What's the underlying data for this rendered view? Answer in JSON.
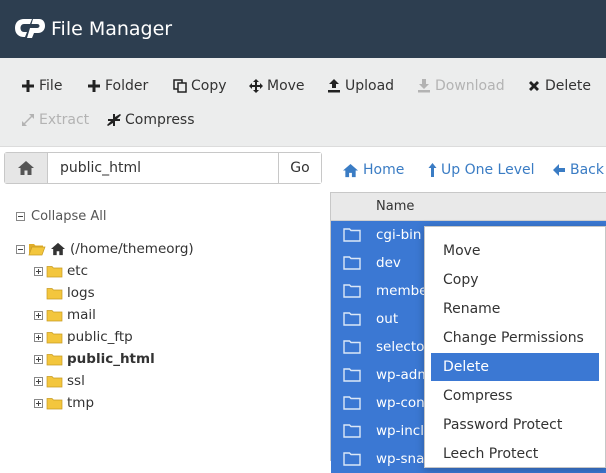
{
  "app": {
    "title": "File Manager",
    "logo_icon": "cpanel-logo-icon"
  },
  "toolbar": {
    "row1": [
      {
        "label": "File",
        "icon": "plus-icon",
        "enabled": true
      },
      {
        "label": "Folder",
        "icon": "plus-icon",
        "enabled": true
      },
      {
        "label": "Copy",
        "icon": "copy-icon",
        "enabled": true
      },
      {
        "label": "Move",
        "icon": "move-arrows-icon",
        "enabled": true
      },
      {
        "label": "Upload",
        "icon": "upload-icon",
        "enabled": true
      },
      {
        "label": "Download",
        "icon": "download-icon",
        "enabled": false
      },
      {
        "label": "Delete",
        "icon": "x-icon",
        "enabled": true
      }
    ],
    "row2": [
      {
        "label": "Extract",
        "icon": "expand-icon",
        "enabled": false
      },
      {
        "label": "Compress",
        "icon": "compress-icon",
        "enabled": true
      }
    ]
  },
  "pathbar": {
    "value": "public_html",
    "go_label": "Go"
  },
  "nav": {
    "home": "Home",
    "up": "Up One Level",
    "back": "Back"
  },
  "tree": {
    "collapse_label": "Collapse All",
    "root": "(/home/themeorg)",
    "items": [
      {
        "label": "etc",
        "expandable": true
      },
      {
        "label": "logs",
        "expandable": false
      },
      {
        "label": "mail",
        "expandable": true
      },
      {
        "label": "public_ftp",
        "expandable": true
      },
      {
        "label": "public_html",
        "expandable": true,
        "current": true
      },
      {
        "label": "ssl",
        "expandable": true
      },
      {
        "label": "tmp",
        "expandable": true
      }
    ]
  },
  "list": {
    "column_name": "Name",
    "rows": [
      {
        "name": "cgi-bin"
      },
      {
        "name": "dev"
      },
      {
        "name": "membe"
      },
      {
        "name": "out"
      },
      {
        "name": "selector"
      },
      {
        "name": "wp-adm"
      },
      {
        "name": "wp-cont"
      },
      {
        "name": "wp-inclu"
      },
      {
        "name": "wp-snap"
      }
    ]
  },
  "context_menu": {
    "items": [
      {
        "label": "Move"
      },
      {
        "label": "Copy"
      },
      {
        "label": "Rename"
      },
      {
        "label": "Change Permissions"
      },
      {
        "label": "Delete",
        "active": true
      },
      {
        "label": "Compress"
      },
      {
        "label": "Password Protect"
      },
      {
        "label": "Leech Protect"
      }
    ]
  },
  "colors": {
    "header_bg": "#2d3e50",
    "selection": "#3b78d3",
    "link": "#3a7cc4",
    "folder": "#f3c63d"
  }
}
